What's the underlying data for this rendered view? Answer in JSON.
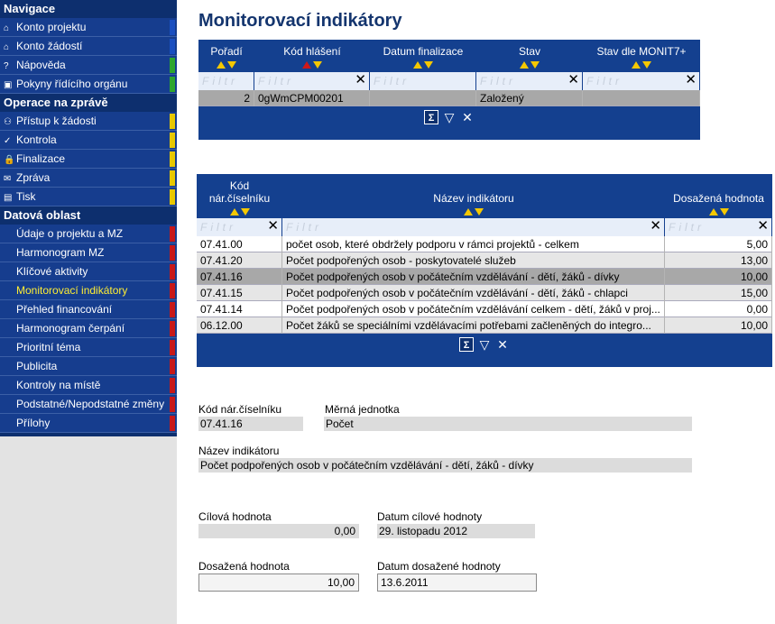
{
  "sidebar": {
    "sections": [
      {
        "title": "Navigace",
        "items": [
          {
            "icon": "⌂",
            "label": "Konto projektu",
            "bar": "#1a4fc0"
          },
          {
            "icon": "⌂",
            "label": "Konto žádostí",
            "bar": "#1a4fc0"
          },
          {
            "icon": "?",
            "label": "Nápověda",
            "bar": "#2ea62e"
          },
          {
            "icon": "▣",
            "label": "Pokyny řídícího orgánu",
            "bar": "#2ea62e"
          }
        ]
      },
      {
        "title": "Operace na zprávě",
        "items": [
          {
            "icon": "⚇",
            "label": "Přístup k žádosti",
            "bar": "#e8c800"
          },
          {
            "icon": "✓",
            "label": "Kontrola",
            "bar": "#e8c800"
          },
          {
            "icon": "🔒",
            "label": "Finalizace",
            "bar": "#e8c800"
          },
          {
            "icon": "✉",
            "label": "Zpráva",
            "bar": "#e8c800"
          },
          {
            "icon": "▤",
            "label": "Tisk",
            "bar": "#e8c800"
          }
        ]
      },
      {
        "title": "Datová oblast",
        "items": [
          {
            "label": "Údaje o projektu a MZ",
            "bar": "#c81818"
          },
          {
            "label": "Harmonogram MZ",
            "bar": "#c81818"
          },
          {
            "label": "Klíčové aktivity",
            "bar": "#c81818"
          },
          {
            "label": "Monitorovací indikátory",
            "bar": "#c81818",
            "active": true
          },
          {
            "label": "Přehled financování",
            "bar": "#c81818"
          },
          {
            "label": "Harmonogram čerpání",
            "bar": "#c81818"
          },
          {
            "label": "Prioritní téma",
            "bar": "#c81818"
          },
          {
            "label": "Publicita",
            "bar": "#c81818"
          },
          {
            "label": "Kontroly na místě",
            "bar": "#c81818"
          },
          {
            "label": "Podstatné/Nepodstatné změny",
            "bar": "#c81818"
          },
          {
            "label": "Přílohy",
            "bar": "#c81818"
          }
        ]
      }
    ]
  },
  "main": {
    "title": "Monitorovací indikátory",
    "filter_placeholder": "Filtr",
    "grid1": {
      "columns": [
        "Pořadí",
        "Kód hlášení",
        "Datum finalizace",
        "Stav",
        "Stav dle MONIT7+"
      ],
      "rows": [
        {
          "poradi": "2",
          "kod": "0gWmCPM00201",
          "datum": "",
          "stav": "Založený",
          "stav_monit": ""
        }
      ]
    },
    "grid2": {
      "columns": [
        "Kód\nnár.číselníku",
        "Název indikátoru",
        "Dosažená hodnota"
      ],
      "rows": [
        {
          "kod": "07.41.00",
          "nazev": "počet osob, které obdržely podporu v rámci projektů - celkem",
          "hodnota": "5,00"
        },
        {
          "kod": "07.41.20",
          "nazev": "Počet podpořených osob - poskytovatelé služeb",
          "hodnota": "13,00"
        },
        {
          "kod": "07.41.16",
          "nazev": "Počet podpořených osob v počátečním vzdělávání - dětí, žáků - dívky",
          "hodnota": "10,00"
        },
        {
          "kod": "07.41.15",
          "nazev": "Počet podpořených osob v počátečním vzdělávání - dětí, žáků - chlapci",
          "hodnota": "15,00"
        },
        {
          "kod": "07.41.14",
          "nazev": "Počet podpořených osob v počátečním vzdělávání celkem - dětí, žáků v proj...",
          "hodnota": "0,00"
        },
        {
          "kod": "06.12.00",
          "nazev": "Počet žáků se speciálními vzdělávacími potřebami začleněných do integro...",
          "hodnota": "10,00"
        }
      ]
    },
    "detail": {
      "kod_label": "Kód nár.číselníku",
      "kod_value": "07.41.16",
      "jednotka_label": "Měrná jednotka",
      "jednotka_value": "Počet",
      "nazev_label": "Název indikátoru",
      "nazev_value": "Počet podpořených osob v počátečním vzdělávání - dětí, žáků - dívky",
      "cilova_label": "Cílová hodnota",
      "cilova_value": "0,00",
      "datum_cilove_label": "Datum cílové hodnoty",
      "datum_cilove_value": "29. listopadu 2012",
      "dosazena_label": "Dosažená hodnota",
      "dosazena_value": "10,00",
      "datum_dosazene_label": "Datum dosažené hodnoty",
      "datum_dosazene_value": "13.6.2011"
    }
  }
}
